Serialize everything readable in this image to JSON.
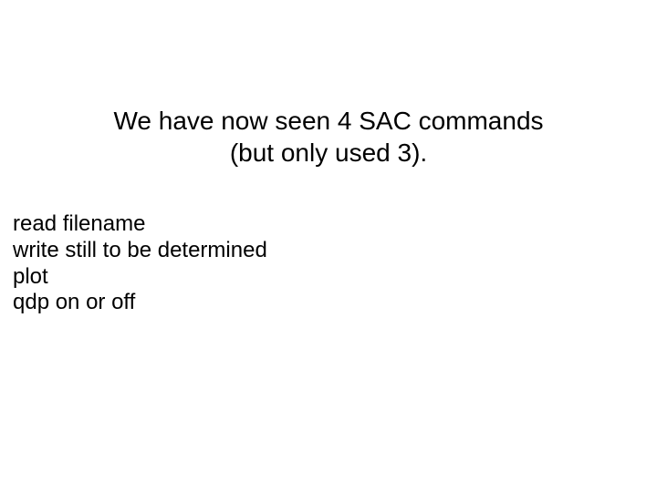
{
  "title": {
    "line1": "We have now seen 4 SAC commands",
    "line2": "(but only used 3)."
  },
  "commands": {
    "line1": "read filename",
    "line2": "write still to be determined",
    "line3": "plot",
    "line4": "qdp on or off"
  }
}
